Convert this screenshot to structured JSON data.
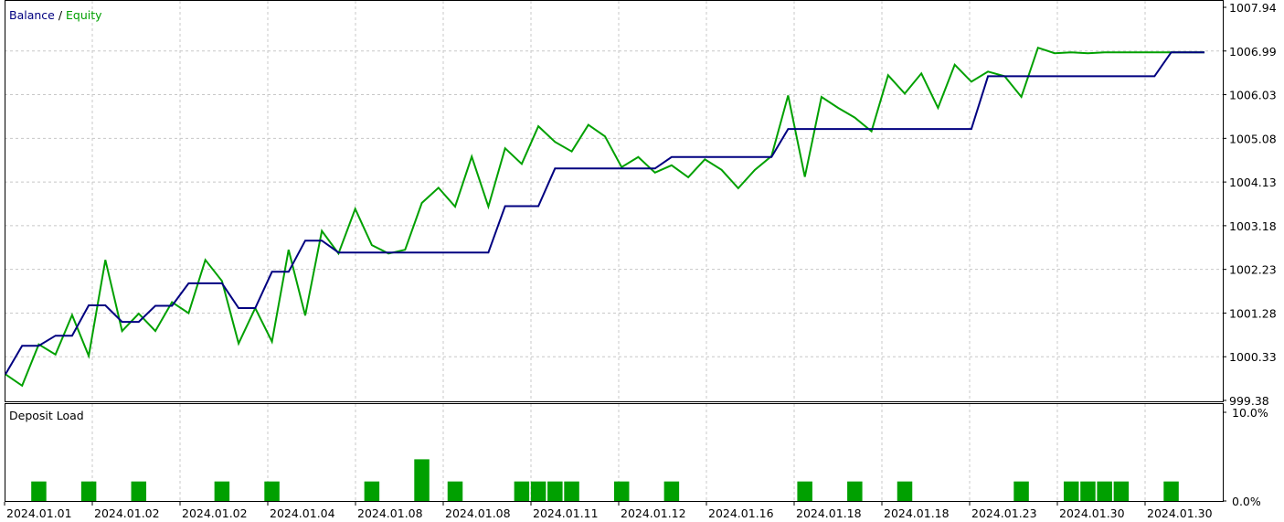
{
  "chart_data": [
    {
      "type": "line",
      "title": "",
      "legend": {
        "placement": "top-left",
        "separator": " / "
      },
      "series": [
        {
          "name": "Balance",
          "color": "#000080",
          "x": [
            0,
            1,
            2,
            3,
            4,
            5,
            6,
            7,
            8,
            9,
            10,
            11,
            12,
            13,
            14,
            15,
            16,
            17,
            18,
            19,
            20,
            21,
            22,
            23,
            24,
            25,
            26,
            27,
            28,
            29,
            30,
            31,
            32,
            33,
            34,
            35,
            36,
            37,
            38,
            39,
            40,
            41,
            42,
            43,
            44,
            45,
            46,
            47,
            48,
            49,
            50,
            51,
            52,
            53,
            54,
            55,
            56,
            57,
            58,
            59,
            60,
            61,
            62,
            63,
            64,
            65,
            66,
            67,
            68,
            69,
            70,
            71,
            72
          ],
          "values": [
            999.95,
            1000.57,
            1000.57,
            1000.79,
            1000.79,
            1001.45,
            1001.45,
            1001.09,
            1001.09,
            1001.44,
            1001.44,
            1001.93,
            1001.93,
            1001.93,
            1001.39,
            1001.39,
            1002.18,
            1002.18,
            1002.86,
            1002.86,
            1002.6,
            1002.6,
            1002.6,
            1002.6,
            1002.6,
            1002.6,
            1002.6,
            1002.6,
            1002.6,
            1002.6,
            1003.61,
            1003.61,
            1003.61,
            1004.43,
            1004.43,
            1004.43,
            1004.43,
            1004.43,
            1004.43,
            1004.43,
            1004.68,
            1004.68,
            1004.68,
            1004.68,
            1004.68,
            1004.68,
            1004.68,
            1005.29,
            1005.29,
            1005.29,
            1005.29,
            1005.29,
            1005.29,
            1005.29,
            1005.29,
            1005.29,
            1005.29,
            1005.29,
            1005.29,
            1006.44,
            1006.44,
            1006.44,
            1006.44,
            1006.44,
            1006.44,
            1006.44,
            1006.44,
            1006.44,
            1006.44,
            1006.44,
            1006.96,
            1006.96,
            1006.96
          ]
        },
        {
          "name": "Equity",
          "color": "#00a000",
          "x": [
            0,
            1,
            2,
            3,
            4,
            5,
            6,
            7,
            8,
            9,
            10,
            11,
            12,
            13,
            14,
            15,
            16,
            17,
            18,
            19,
            20,
            21,
            22,
            23,
            24,
            25,
            26,
            27,
            28,
            29,
            30,
            31,
            32,
            33,
            34,
            35,
            36,
            37,
            38,
            39,
            40,
            41,
            42,
            43,
            44,
            45,
            46,
            47,
            48,
            49,
            50,
            51,
            52,
            53,
            54,
            55,
            56,
            57,
            58,
            59,
            60,
            61,
            62,
            63,
            64,
            65,
            66,
            67,
            68,
            69,
            70,
            71,
            72
          ],
          "values": [
            999.95,
            999.7,
            1000.6,
            1000.38,
            1001.24,
            1000.35,
            1002.44,
            1000.89,
            1001.27,
            1000.89,
            1001.52,
            1001.28,
            1002.44,
            1001.98,
            1000.62,
            1001.39,
            1000.66,
            1002.66,
            1001.23,
            1003.07,
            1002.58,
            1003.55,
            1002.76,
            1002.58,
            1002.66,
            1003.68,
            1004.01,
            1003.6,
            1004.69,
            1003.6,
            1004.87,
            1004.53,
            1005.35,
            1005.01,
            1004.8,
            1005.38,
            1005.13,
            1004.46,
            1004.68,
            1004.34,
            1004.5,
            1004.24,
            1004.63,
            1004.4,
            1004.0,
            1004.4,
            1004.7,
            1006.02,
            1004.25,
            1005.99,
            1005.75,
            1005.54,
            1005.24,
            1006.46,
            1006.06,
            1006.5,
            1005.75,
            1006.69,
            1006.32,
            1006.54,
            1006.44,
            1005.99,
            1007.06,
            1006.94,
            1006.96,
            1006.94,
            1006.96,
            1006.96,
            1006.96,
            1006.96,
            1006.96,
            1006.96,
            1006.96
          ]
        }
      ],
      "xlabel": "",
      "ylabel": "",
      "ylim": [
        999.38,
        1007.94
      ],
      "yticks": [
        "1007.94",
        "1006.99",
        "1006.03",
        "1005.08",
        "1004.13",
        "1003.18",
        "1002.23",
        "1001.28",
        "1000.33",
        "999.38"
      ],
      "grid": true
    },
    {
      "type": "bar",
      "title": "Deposit Load",
      "ylim": [
        0,
        10
      ],
      "yticks": [
        "10.0%",
        "0.0%"
      ],
      "color": "#00a000",
      "x": [
        2,
        5,
        8,
        13,
        16,
        22,
        25,
        27,
        31,
        32,
        33,
        34,
        37,
        40,
        48,
        51,
        54,
        61,
        64,
        65,
        66,
        67,
        70
      ],
      "values": [
        2.2,
        2.2,
        2.2,
        2.2,
        2.2,
        2.2,
        4.7,
        2.2,
        2.2,
        2.2,
        2.2,
        2.2,
        2.2,
        2.2,
        2.2,
        2.2,
        2.2,
        2.2,
        2.2,
        2.2,
        2.2,
        2.2,
        2.2
      ],
      "xticks": [
        "2024.01.01",
        "2024.01.02",
        "2024.01.02",
        "2024.01.04",
        "2024.01.08",
        "2024.01.08",
        "2024.01.11",
        "2024.01.12",
        "2024.01.16",
        "2024.01.18",
        "2024.01.18",
        "2024.01.23",
        "2024.01.30",
        "2024.01.30"
      ],
      "grid": true
    }
  ]
}
